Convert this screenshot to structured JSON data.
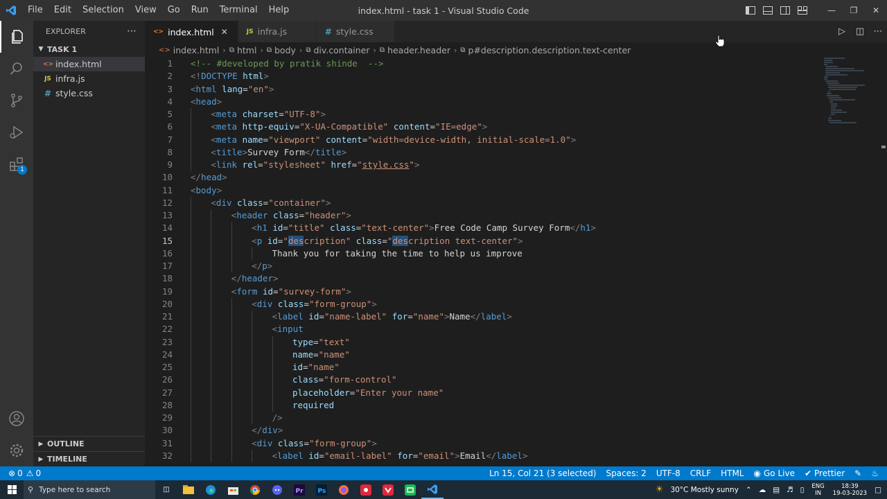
{
  "titlebar": {
    "menus": [
      "File",
      "Edit",
      "Selection",
      "View",
      "Go",
      "Run",
      "Terminal",
      "Help"
    ],
    "title": "index.html - task 1 - Visual Studio Code"
  },
  "sidebar": {
    "header": "EXPLORER",
    "folder": "TASK 1",
    "files": [
      {
        "name": "index.html",
        "icon": "<>",
        "color": "#e37933"
      },
      {
        "name": "infra.js",
        "icon": "JS",
        "color": "#cbcb41"
      },
      {
        "name": "style.css",
        "icon": "#",
        "color": "#519aba"
      }
    ],
    "outline": "OUTLINE",
    "timeline": "TIMELINE"
  },
  "activity": {
    "extensions_badge": "1"
  },
  "tabs": [
    {
      "label": "index.html",
      "icon": "<>",
      "color": "#e37933"
    },
    {
      "label": "infra.js",
      "icon": "JS",
      "color": "#cbcb41"
    },
    {
      "label": "style.css",
      "icon": "#",
      "color": "#519aba"
    }
  ],
  "breadcrumb": [
    "index.html",
    "html",
    "body",
    "div.container",
    "header.header",
    "p#description.description.text-center"
  ],
  "code_lines": [
    {
      "n": "1",
      "indent": 0,
      "seg": [
        [
          "t-c",
          "<!-- #developed by pratik shinde  -->"
        ]
      ]
    },
    {
      "n": "2",
      "indent": 0,
      "seg": [
        [
          "t-p",
          "<!"
        ],
        [
          "t-t",
          "DOCTYPE"
        ],
        [
          "t-x",
          " "
        ],
        [
          "t-a",
          "html"
        ],
        [
          "t-p",
          ">"
        ]
      ]
    },
    {
      "n": "3",
      "indent": 0,
      "seg": [
        [
          "t-p",
          "<"
        ],
        [
          "t-t",
          "html"
        ],
        [
          "t-x",
          " "
        ],
        [
          "t-a",
          "lang"
        ],
        [
          "t-x",
          "="
        ],
        [
          "t-s",
          "\"en\""
        ],
        [
          "t-p",
          ">"
        ]
      ]
    },
    {
      "n": "4",
      "indent": 0,
      "seg": [
        [
          "t-p",
          "<"
        ],
        [
          "t-t",
          "head"
        ],
        [
          "t-p",
          ">"
        ]
      ]
    },
    {
      "n": "5",
      "indent": 1,
      "seg": [
        [
          "t-p",
          "<"
        ],
        [
          "t-t",
          "meta"
        ],
        [
          "t-x",
          " "
        ],
        [
          "t-a",
          "charset"
        ],
        [
          "t-x",
          "="
        ],
        [
          "t-s",
          "\"UTF-8\""
        ],
        [
          "t-p",
          ">"
        ]
      ]
    },
    {
      "n": "6",
      "indent": 1,
      "seg": [
        [
          "t-p",
          "<"
        ],
        [
          "t-t",
          "meta"
        ],
        [
          "t-x",
          " "
        ],
        [
          "t-a",
          "http-equiv"
        ],
        [
          "t-x",
          "="
        ],
        [
          "t-s",
          "\"X-UA-Compatible\""
        ],
        [
          "t-x",
          " "
        ],
        [
          "t-a",
          "content"
        ],
        [
          "t-x",
          "="
        ],
        [
          "t-s",
          "\"IE=edge\""
        ],
        [
          "t-p",
          ">"
        ]
      ]
    },
    {
      "n": "7",
      "indent": 1,
      "seg": [
        [
          "t-p",
          "<"
        ],
        [
          "t-t",
          "meta"
        ],
        [
          "t-x",
          " "
        ],
        [
          "t-a",
          "name"
        ],
        [
          "t-x",
          "="
        ],
        [
          "t-s",
          "\"viewport\""
        ],
        [
          "t-x",
          " "
        ],
        [
          "t-a",
          "content"
        ],
        [
          "t-x",
          "="
        ],
        [
          "t-s",
          "\"width=device-width, initial-scale=1.0\""
        ],
        [
          "t-p",
          ">"
        ]
      ]
    },
    {
      "n": "8",
      "indent": 1,
      "seg": [
        [
          "t-p",
          "<"
        ],
        [
          "t-t",
          "title"
        ],
        [
          "t-p",
          ">"
        ],
        [
          "t-x",
          "Survey Form"
        ],
        [
          "t-p",
          "</"
        ],
        [
          "t-t",
          "title"
        ],
        [
          "t-p",
          ">"
        ]
      ]
    },
    {
      "n": "9",
      "indent": 1,
      "seg": [
        [
          "t-p",
          "<"
        ],
        [
          "t-t",
          "link"
        ],
        [
          "t-x",
          " "
        ],
        [
          "t-a",
          "rel"
        ],
        [
          "t-x",
          "="
        ],
        [
          "t-s",
          "\"stylesheet\""
        ],
        [
          "t-x",
          " "
        ],
        [
          "t-a",
          "href"
        ],
        [
          "t-x",
          "="
        ],
        [
          "t-s",
          "\""
        ],
        [
          "t-u",
          "style.css"
        ],
        [
          "t-s",
          "\""
        ],
        [
          "t-p",
          ">"
        ]
      ]
    },
    {
      "n": "10",
      "indent": 0,
      "seg": [
        [
          "t-p",
          "</"
        ],
        [
          "t-t",
          "head"
        ],
        [
          "t-p",
          ">"
        ]
      ]
    },
    {
      "n": "11",
      "indent": 0,
      "seg": [
        [
          "t-p",
          "<"
        ],
        [
          "t-t",
          "body"
        ],
        [
          "t-p",
          ">"
        ]
      ]
    },
    {
      "n": "12",
      "indent": 1,
      "seg": [
        [
          "t-p",
          "<"
        ],
        [
          "t-t",
          "div"
        ],
        [
          "t-x",
          " "
        ],
        [
          "t-a",
          "class"
        ],
        [
          "t-x",
          "="
        ],
        [
          "t-s",
          "\"container\""
        ],
        [
          "t-p",
          ">"
        ]
      ]
    },
    {
      "n": "13",
      "indent": 2,
      "seg": [
        [
          "t-p",
          "<"
        ],
        [
          "t-t",
          "header"
        ],
        [
          "t-x",
          " "
        ],
        [
          "t-a",
          "class"
        ],
        [
          "t-x",
          "="
        ],
        [
          "t-s",
          "\"header\""
        ],
        [
          "t-p",
          ">"
        ]
      ]
    },
    {
      "n": "14",
      "indent": 3,
      "seg": [
        [
          "t-p",
          "<"
        ],
        [
          "t-t",
          "h1"
        ],
        [
          "t-x",
          " "
        ],
        [
          "t-a",
          "id"
        ],
        [
          "t-x",
          "="
        ],
        [
          "t-s",
          "\"title\""
        ],
        [
          "t-x",
          " "
        ],
        [
          "t-a",
          "class"
        ],
        [
          "t-x",
          "="
        ],
        [
          "t-s",
          "\"text-center\""
        ],
        [
          "t-p",
          ">"
        ],
        [
          "t-x",
          "Free Code Camp Survey Form"
        ],
        [
          "t-p",
          "</"
        ],
        [
          "t-t",
          "h1"
        ],
        [
          "t-p",
          ">"
        ]
      ]
    },
    {
      "n": "15",
      "indent": 3,
      "current": true,
      "seg": [
        [
          "t-p",
          "<"
        ],
        [
          "t-t",
          "p"
        ],
        [
          "t-x",
          " "
        ],
        [
          "t-a",
          "id"
        ],
        [
          "t-x",
          "="
        ],
        [
          "t-s",
          "\""
        ],
        [
          "t-s sel",
          "des"
        ],
        [
          "t-s",
          "cription\""
        ],
        [
          "t-x",
          " "
        ],
        [
          "t-a",
          "class"
        ],
        [
          "t-x",
          "="
        ],
        [
          "t-s",
          "\""
        ],
        [
          "t-s sel",
          "des"
        ],
        [
          "t-s",
          "cription text-center\""
        ],
        [
          "t-p",
          ">"
        ]
      ]
    },
    {
      "n": "16",
      "indent": 4,
      "seg": [
        [
          "t-x",
          "Thank you for taking the time to help us improve"
        ]
      ]
    },
    {
      "n": "17",
      "indent": 3,
      "seg": [
        [
          "t-p",
          "</"
        ],
        [
          "t-t",
          "p"
        ],
        [
          "t-p",
          ">"
        ]
      ]
    },
    {
      "n": "18",
      "indent": 2,
      "seg": [
        [
          "t-p",
          "</"
        ],
        [
          "t-t",
          "header"
        ],
        [
          "t-p",
          ">"
        ]
      ]
    },
    {
      "n": "19",
      "indent": 2,
      "seg": [
        [
          "t-p",
          "<"
        ],
        [
          "t-t",
          "form"
        ],
        [
          "t-x",
          " "
        ],
        [
          "t-a",
          "id"
        ],
        [
          "t-x",
          "="
        ],
        [
          "t-s",
          "\"survey-form\""
        ],
        [
          "t-p",
          ">"
        ]
      ]
    },
    {
      "n": "20",
      "indent": 3,
      "seg": [
        [
          "t-p",
          "<"
        ],
        [
          "t-t",
          "div"
        ],
        [
          "t-x",
          " "
        ],
        [
          "t-a",
          "class"
        ],
        [
          "t-x",
          "="
        ],
        [
          "t-s",
          "\"form-group\""
        ],
        [
          "t-p",
          ">"
        ]
      ]
    },
    {
      "n": "21",
      "indent": 4,
      "seg": [
        [
          "t-p",
          "<"
        ],
        [
          "t-t",
          "label"
        ],
        [
          "t-x",
          " "
        ],
        [
          "t-a",
          "id"
        ],
        [
          "t-x",
          "="
        ],
        [
          "t-s",
          "\"name-label\""
        ],
        [
          "t-x",
          " "
        ],
        [
          "t-a",
          "for"
        ],
        [
          "t-x",
          "="
        ],
        [
          "t-s",
          "\"name\""
        ],
        [
          "t-p",
          ">"
        ],
        [
          "t-x",
          "Name"
        ],
        [
          "t-p",
          "</"
        ],
        [
          "t-t",
          "label"
        ],
        [
          "t-p",
          ">"
        ]
      ]
    },
    {
      "n": "22",
      "indent": 4,
      "seg": [
        [
          "t-p",
          "<"
        ],
        [
          "t-t",
          "input"
        ]
      ]
    },
    {
      "n": "23",
      "indent": 5,
      "seg": [
        [
          "t-a",
          "type"
        ],
        [
          "t-x",
          "="
        ],
        [
          "t-s",
          "\"text\""
        ]
      ]
    },
    {
      "n": "24",
      "indent": 5,
      "seg": [
        [
          "t-a",
          "name"
        ],
        [
          "t-x",
          "="
        ],
        [
          "t-s",
          "\"name\""
        ]
      ]
    },
    {
      "n": "25",
      "indent": 5,
      "seg": [
        [
          "t-a",
          "id"
        ],
        [
          "t-x",
          "="
        ],
        [
          "t-s",
          "\"name\""
        ]
      ]
    },
    {
      "n": "26",
      "indent": 5,
      "seg": [
        [
          "t-a",
          "class"
        ],
        [
          "t-x",
          "="
        ],
        [
          "t-s",
          "\"form-control\""
        ]
      ]
    },
    {
      "n": "27",
      "indent": 5,
      "seg": [
        [
          "t-a",
          "placeholder"
        ],
        [
          "t-x",
          "="
        ],
        [
          "t-s",
          "\"Enter your name\""
        ]
      ]
    },
    {
      "n": "28",
      "indent": 5,
      "seg": [
        [
          "t-a",
          "required"
        ]
      ]
    },
    {
      "n": "29",
      "indent": 4,
      "seg": [
        [
          "t-p",
          "/>"
        ]
      ]
    },
    {
      "n": "30",
      "indent": 3,
      "seg": [
        [
          "t-p",
          "</"
        ],
        [
          "t-t",
          "div"
        ],
        [
          "t-p",
          ">"
        ]
      ]
    },
    {
      "n": "31",
      "indent": 3,
      "seg": [
        [
          "t-p",
          "<"
        ],
        [
          "t-t",
          "div"
        ],
        [
          "t-x",
          " "
        ],
        [
          "t-a",
          "class"
        ],
        [
          "t-x",
          "="
        ],
        [
          "t-s",
          "\"form-group\""
        ],
        [
          "t-p",
          ">"
        ]
      ]
    },
    {
      "n": "32",
      "indent": 4,
      "seg": [
        [
          "t-p",
          "<"
        ],
        [
          "t-t",
          "label"
        ],
        [
          "t-x",
          " "
        ],
        [
          "t-a",
          "id"
        ],
        [
          "t-x",
          "="
        ],
        [
          "t-s",
          "\"email-label\""
        ],
        [
          "t-x",
          " "
        ],
        [
          "t-a",
          "for"
        ],
        [
          "t-x",
          "="
        ],
        [
          "t-s",
          "\"email\""
        ],
        [
          "t-p",
          ">"
        ],
        [
          "t-x",
          "Email"
        ],
        [
          "t-p",
          "</"
        ],
        [
          "t-t",
          "label"
        ],
        [
          "t-p",
          ">"
        ]
      ]
    }
  ],
  "status": {
    "errors": "0",
    "warnings": "0",
    "position": "Ln 15, Col 21 (3 selected)",
    "spaces": "Spaces: 2",
    "encoding": "UTF-8",
    "eol": "CRLF",
    "language": "HTML",
    "golive": "Go Live",
    "prettier": "Prettier"
  },
  "taskbar": {
    "search_placeholder": "Type here to search",
    "weather": "30°C  Mostly sunny",
    "lang": "ENG",
    "region": "IN",
    "time": "18:39",
    "date": "19-03-2023"
  },
  "colors": {
    "accent": "#007acc",
    "titlebar": "#323233",
    "sidebar": "#252526",
    "editor": "#1e1e1e"
  }
}
